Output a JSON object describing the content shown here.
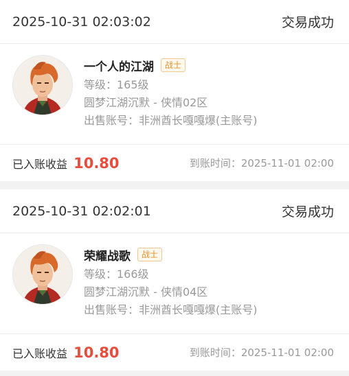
{
  "orders": [
    {
      "time": "2025-10-31 02:03:02",
      "status": "交易成功",
      "character_name": "一个人的江湖",
      "class_badge": "战士",
      "level": "等级：165级",
      "server": "圆梦江湖沉默 - 侠情02区",
      "seller_account": "出售账号：非洲酋长嘎嘎爆(主账号)",
      "income_label": "已入账收益",
      "income_value": "10.80",
      "arrival_time": "到账时间：2025-11-01 02:00"
    },
    {
      "time": "2025-10-31 02:02:01",
      "status": "交易成功",
      "character_name": "荣耀战歌",
      "class_badge": "战士",
      "level": "等级：166级",
      "server": "圆梦江湖沉默 - 侠情04区",
      "seller_account": "出售账号：非洲酋长嘎嘎爆(主账号)",
      "income_label": "已入账收益",
      "income_value": "10.80",
      "arrival_time": "到账时间：2025-11-01 02:00"
    }
  ],
  "colors": {
    "income_red": "#e84c3d",
    "badge_orange": "#e8902a",
    "hair_orange": "#d9692a"
  },
  "icons": {
    "avatar": "warrior-portrait"
  }
}
